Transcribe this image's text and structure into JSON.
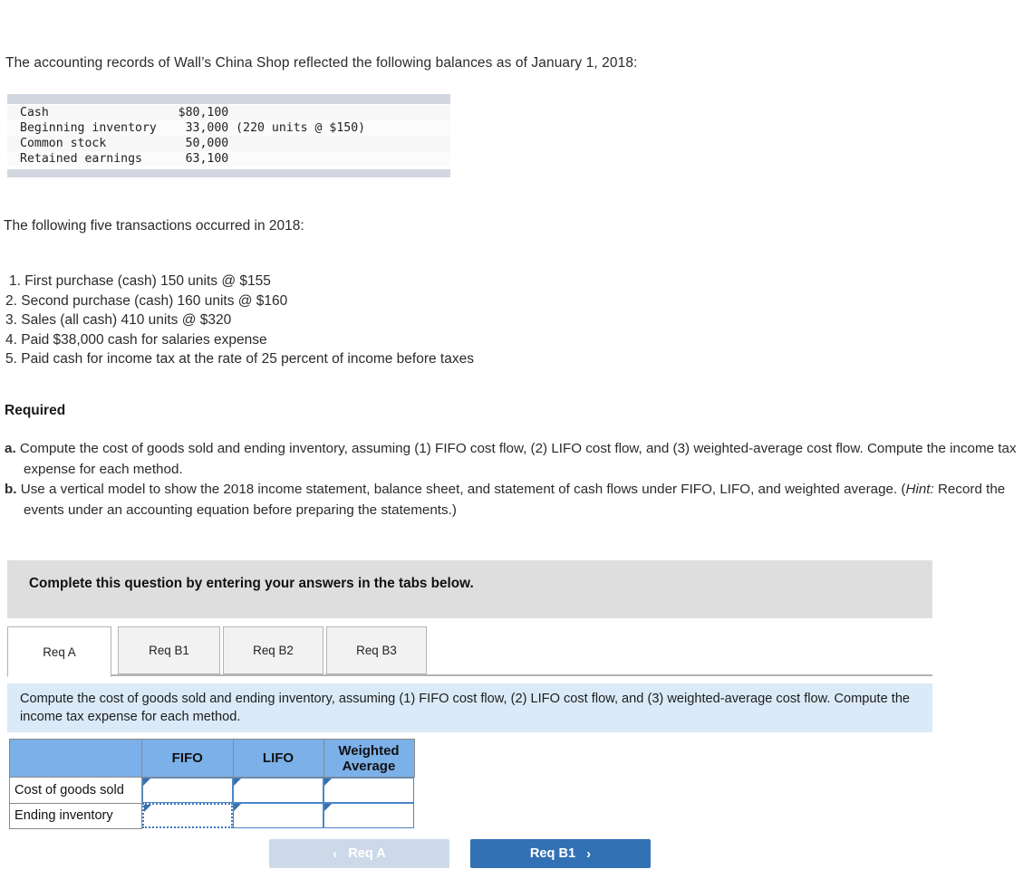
{
  "intro": "The accounting records of Wall’s China Shop reflected the following balances as of January 1, 2018:",
  "balances": {
    "rows": [
      {
        "label": "Cash",
        "amount": "$80,100",
        "note": ""
      },
      {
        "label": "Beginning inventory",
        "amount": " 33,000",
        "note": " (220 units @ $150)"
      },
      {
        "label": "Common stock",
        "amount": " 50,000",
        "note": ""
      },
      {
        "label": "Retained earnings",
        "amount": " 63,100",
        "note": ""
      }
    ]
  },
  "transactions_intro": "The following five transactions occurred in 2018:",
  "transactions": [
    "1. First purchase (cash) 150 units @ $155",
    "2. Second purchase (cash) 160 units @ $160",
    "3. Sales (all cash) 410 units @ $320",
    "4. Paid $38,000 cash for salaries expense",
    "5. Paid cash for income tax at the rate of 25 percent of income before taxes"
  ],
  "required": {
    "heading": "Required",
    "items": [
      {
        "mark": "a.",
        "text": "Compute the cost of goods sold and ending inventory, assuming (1) FIFO cost flow, (2) LIFO cost flow, and (3) weighted-average cost flow. Compute the income tax expense for each method."
      },
      {
        "mark": "b.",
        "text_before": "Use a vertical model to show the 2018 income statement, balance sheet, and statement of cash flows under FIFO, LIFO, and weighted average. (",
        "emphasis": "Hint:",
        "text_after": " Record the events under an accounting equation before preparing the statements.)"
      }
    ]
  },
  "instruction_bar": "Complete this question by entering your answers in the tabs below.",
  "tabs": [
    {
      "label": "Req A",
      "active": true
    },
    {
      "label": "Req B1",
      "active": false
    },
    {
      "label": "Req B2",
      "active": false
    },
    {
      "label": "Req B3",
      "active": false
    }
  ],
  "tab_instruction": "Compute the cost of goods sold and ending inventory, assuming (1) FIFO cost flow, (2) LIFO cost flow, and (3) weighted-average cost flow. Compute the income tax expense for each method.",
  "answer_table": {
    "corner_header": "",
    "columns": [
      "FIFO",
      "LIFO",
      "Weighted Average"
    ],
    "rows": [
      {
        "label": "Cost of goods sold",
        "values": [
          "",
          "",
          ""
        ]
      },
      {
        "label": "Ending inventory",
        "values": [
          "",
          "",
          ""
        ]
      }
    ],
    "focused_cell": {
      "row": 1,
      "col": 0
    }
  },
  "nav": {
    "prev_label": "Req A",
    "prev_icon": "chevron-left-icon",
    "prev_glyph": "‹",
    "prev_disabled": true,
    "next_label": "Req B1",
    "next_icon": "chevron-right-icon",
    "next_glyph": "›"
  },
  "colors": {
    "header_blue": "#7cb0e8",
    "panel_blue": "#daeaf8",
    "button_blue": "#3371b5",
    "button_disabled": "#cdd9e8",
    "grey_bar": "#dedede",
    "table_bar": "#d2d6e0"
  }
}
